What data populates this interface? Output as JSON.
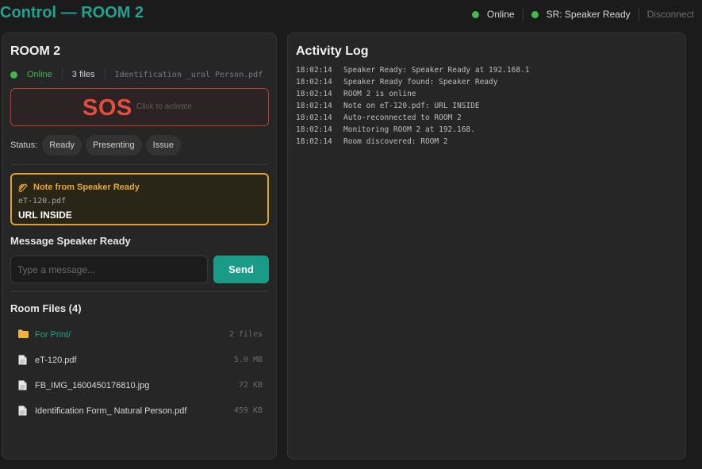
{
  "header": {
    "title": "Control — ROOM 2",
    "status_online": "Online",
    "speaker_status": "SR: Speaker Ready",
    "disconnect_label": "Disconnect"
  },
  "room": {
    "name": "ROOM 2",
    "online_label": "Online",
    "files_count": "3 files",
    "current_file": "Identification _ural Person.pdf",
    "sos_label": "SOS",
    "sos_hint": "Click to activate",
    "status_label": "Status:",
    "statuses": [
      "Ready",
      "Presenting",
      "Issue"
    ]
  },
  "note": {
    "title": "Note from Speaker Ready",
    "file": "eT-120.pdf",
    "message": "URL INSIDE"
  },
  "message": {
    "title": "Message Speaker Ready",
    "placeholder": "Type a message...",
    "send_label": "Send"
  },
  "files": {
    "title": "Room Files (4)",
    "items": [
      {
        "name": "For Print/",
        "size": "2 files",
        "icon": "folder-icon"
      },
      {
        "name": "eT-120.pdf",
        "size": "5.0 MB",
        "icon": "file-icon"
      },
      {
        "name": "FB_IMG_1600450176810.jpg",
        "size": "72 KB",
        "icon": "file-icon"
      },
      {
        "name": "Identification Form_ Natural Person.pdf",
        "size": "459 KB",
        "icon": "file-icon"
      }
    ]
  },
  "log": {
    "title": "Activity Log",
    "entries": [
      {
        "time": "18:02:14",
        "text": "Speaker Ready: Speaker Ready at 192.168.1"
      },
      {
        "time": "18:02:14",
        "text": "Speaker Ready found: Speaker Ready"
      },
      {
        "time": "18:02:14",
        "text": "ROOM 2 is online"
      },
      {
        "time": "18:02:14",
        "text": "Note on eT-120.pdf: URL INSIDE"
      },
      {
        "time": "18:02:14",
        "text": "Auto-reconnected to ROOM 2"
      },
      {
        "time": "18:02:14",
        "text": "Monitoring ROOM 2 at 192.168."
      },
      {
        "time": "18:02:14",
        "text": "Room discovered: ROOM 2"
      }
    ]
  },
  "colors": {
    "accent": "#21a28f",
    "online": "#3fb950",
    "sos": "#e74c3c",
    "note_border": "#e0a030",
    "send": "#1a9b87"
  }
}
